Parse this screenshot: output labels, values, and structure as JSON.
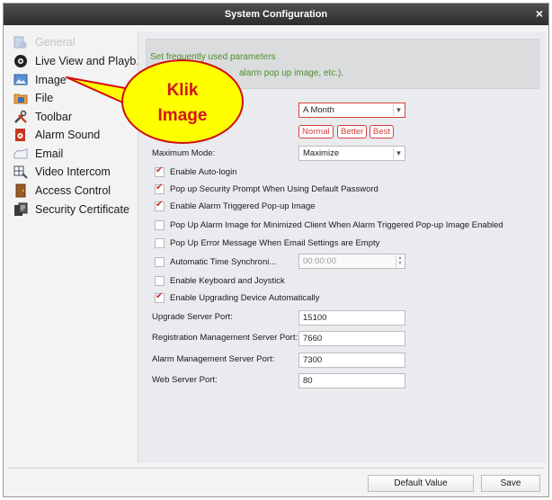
{
  "window": {
    "title": "System Configuration",
    "close_glyph": "×"
  },
  "sidebar": {
    "items": [
      {
        "label": "General",
        "icon": "general-icon",
        "disabled": true
      },
      {
        "label": "Live View and Playb...",
        "icon": "camera-icon"
      },
      {
        "label": "Image",
        "icon": "image-icon"
      },
      {
        "label": "File",
        "icon": "folder-icon"
      },
      {
        "label": "Toolbar",
        "icon": "tools-icon"
      },
      {
        "label": "Alarm Sound",
        "icon": "alarm-sound-icon"
      },
      {
        "label": "Email",
        "icon": "email-icon"
      },
      {
        "label": "Video Intercom",
        "icon": "intercom-icon"
      },
      {
        "label": "Access Control",
        "icon": "access-control-icon"
      },
      {
        "label": "Security Certificate",
        "icon": "certificate-icon"
      }
    ]
  },
  "tip": {
    "line1": "Set frequently used parameters",
    "line2": "alarm pop up image, etc.)."
  },
  "settings": {
    "log_period": "A Month",
    "performance_options": [
      "Normal",
      "Better",
      "Best"
    ],
    "maximum_mode_label": "Maximum Mode:",
    "maximum_mode_value": "Maximize",
    "checkboxes": [
      {
        "label": "Enable Auto-login",
        "checked": true
      },
      {
        "label": "Pop up Security Prompt When Using Default Password",
        "checked": true
      },
      {
        "label": "Enable Alarm Triggered Pop-up Image",
        "checked": true
      },
      {
        "label": "Pop Up Alarm Image for Minimized Client When Alarm Triggered Pop-up Image Enabled",
        "checked": false
      },
      {
        "label": "Pop Up Error Message When Email Settings are Empty",
        "checked": false
      },
      {
        "label": "Automatic Time Synchroni...",
        "checked": false
      },
      {
        "label": "Enable Keyboard and Joystick",
        "checked": false
      },
      {
        "label": "Enable Upgrading Device Automatically",
        "checked": true
      }
    ],
    "time_sync_value": "00:00:00",
    "ports": [
      {
        "label": "Upgrade Server Port:",
        "value": "15100"
      },
      {
        "label": "Registration Management Server Port:",
        "value": "7660"
      },
      {
        "label": "Alarm Management Server Port:",
        "value": "7300"
      },
      {
        "label": "Web Server Port:",
        "value": "80"
      }
    ]
  },
  "buttons": {
    "default": "Default Value",
    "save": "Save"
  },
  "callout": {
    "line1": "Klik",
    "line2": "Image"
  },
  "colors": {
    "accent": "#d54040",
    "tip_text": "#4d8f2a",
    "callout_fill": "#ffff00",
    "callout_text": "#d0161c"
  }
}
